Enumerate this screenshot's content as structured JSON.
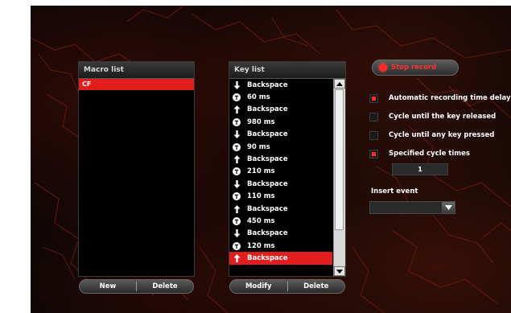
{
  "macro_panel": {
    "header": "Macro list",
    "items": [
      {
        "label": "CF",
        "selected": true
      }
    ],
    "buttons": {
      "new": "New",
      "delete": "Delete"
    }
  },
  "key_panel": {
    "header": "Key list",
    "items": [
      {
        "icon": "arrow-down-icon",
        "label": "Backspace"
      },
      {
        "icon": "timer-icon",
        "label": "60 ms"
      },
      {
        "icon": "arrow-up-icon",
        "label": "Backspace"
      },
      {
        "icon": "timer-icon",
        "label": "980 ms"
      },
      {
        "icon": "arrow-down-icon",
        "label": "Backspace"
      },
      {
        "icon": "timer-icon",
        "label": "90 ms"
      },
      {
        "icon": "arrow-up-icon",
        "label": "Backspace"
      },
      {
        "icon": "timer-icon",
        "label": "210 ms"
      },
      {
        "icon": "arrow-down-icon",
        "label": "Backspace"
      },
      {
        "icon": "timer-icon",
        "label": "110 ms"
      },
      {
        "icon": "arrow-up-icon",
        "label": "Backspace"
      },
      {
        "icon": "timer-icon",
        "label": "450 ms"
      },
      {
        "icon": "arrow-down-icon",
        "label": "Backspace"
      },
      {
        "icon": "timer-icon",
        "label": "120 ms"
      },
      {
        "icon": "arrow-up-icon",
        "label": "Backspace",
        "selected": true
      }
    ],
    "buttons": {
      "modify": "Modify",
      "delete": "Delete"
    }
  },
  "recording": {
    "stop_label": "Stop record",
    "options": [
      {
        "label": "Automatic recording time delay",
        "checked": true
      },
      {
        "label": "Cycle until the key released",
        "checked": false
      },
      {
        "label": "Cycle until any key pressed",
        "checked": false
      },
      {
        "label": "Specified cycle times",
        "checked": true
      }
    ],
    "cycle_count": "1",
    "insert_event_label": "Insert event",
    "insert_event_value": ""
  },
  "colors": {
    "accent": "#e11d1d",
    "background": "#0b0605",
    "text": "#ffffff"
  }
}
